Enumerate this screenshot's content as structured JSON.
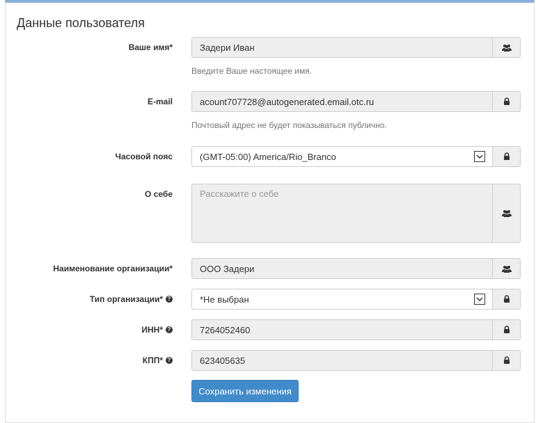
{
  "title": "Данные пользователя",
  "fields": {
    "name": {
      "label": "Ваше имя*",
      "value": "Задери Иван",
      "hint": "Введите Ваше настоящее имя.",
      "addon_icon": "users-icon"
    },
    "email": {
      "label": "E-mail",
      "value": "acount707728@autogenerated.email.otc.ru",
      "hint": "Почтовый адрес не будет показываться публично.",
      "addon_icon": "lock-icon"
    },
    "timezone": {
      "label": "Часовой пояс",
      "value": "(GMT-05:00) America/Rio_Branco",
      "addon_icon": "lock-icon"
    },
    "about": {
      "label": "О себе",
      "placeholder": "Расскажите о себе",
      "addon_icon": "users-icon"
    },
    "org_name": {
      "label": "Наименование организации*",
      "value": "ООО Задери",
      "addon_icon": "users-icon"
    },
    "org_type": {
      "label": "Тип организации*",
      "value": "*Не выбран",
      "addon_icon": "lock-icon"
    },
    "inn": {
      "label": "ИНН*",
      "value": "7264052460",
      "addon_icon": "lock-icon"
    },
    "kpp": {
      "label": "КПП*",
      "value": "623405635",
      "addon_icon": "lock-icon"
    }
  },
  "save_button": "Сохранить изменения",
  "colors": {
    "accent": "#428bca",
    "top_border": "#8aaedb"
  }
}
